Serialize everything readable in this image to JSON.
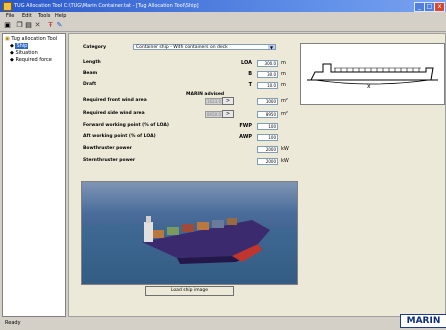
{
  "window": {
    "title": "TUG Allocation Tool C:\\TUG\\Marin Container.tat - [Tug Allocation Tool\\Ship]",
    "buttons": [
      "_",
      "□",
      "x"
    ]
  },
  "menu": [
    "File",
    "Edit",
    "Tools",
    "Help"
  ],
  "toolbar": {
    "icons": [
      "save-icon",
      "copy-icon",
      "paste-icon",
      "delete-icon",
      "wind-icon",
      "tools-icon"
    ]
  },
  "tree": {
    "root": "Tug allocation Tool",
    "items": [
      "Ship",
      "Situation",
      "Required force"
    ]
  },
  "form": {
    "category_label": "Category",
    "category_value": "Container ship - With containers on deck",
    "rows": [
      {
        "label": "Length",
        "symbol": "LOA",
        "value": "300.0",
        "unit": "m"
      },
      {
        "label": "Beam",
        "symbol": "B",
        "value": "30.0",
        "unit": "m"
      },
      {
        "label": "Draft",
        "symbol": "T",
        "value": "10.0",
        "unit": "m"
      }
    ],
    "advised_header": "MARIN advised",
    "areas": [
      {
        "label": "Required front wind area",
        "advised": "1623.0",
        "value": "1000",
        "unit": "m²"
      },
      {
        "label": "Required side wind area",
        "advised": "8950.0",
        "value": "8950",
        "unit": "m²"
      }
    ],
    "points": [
      {
        "label": "Forward working point (% of LOA)",
        "symbol": "FWP",
        "value": "100"
      },
      {
        "label": "Aft working point (% of LOA)",
        "symbol": "AWP",
        "value": "100"
      }
    ],
    "thrusters": [
      {
        "label": "Bowthruster power",
        "value": "2000",
        "unit": "kW"
      },
      {
        "label": "Sternthruster power",
        "value": "2000",
        "unit": "kW"
      }
    ],
    "arrow": ">"
  },
  "load_button": "Load ship image",
  "logo": "MARIN",
  "status": "Ready"
}
